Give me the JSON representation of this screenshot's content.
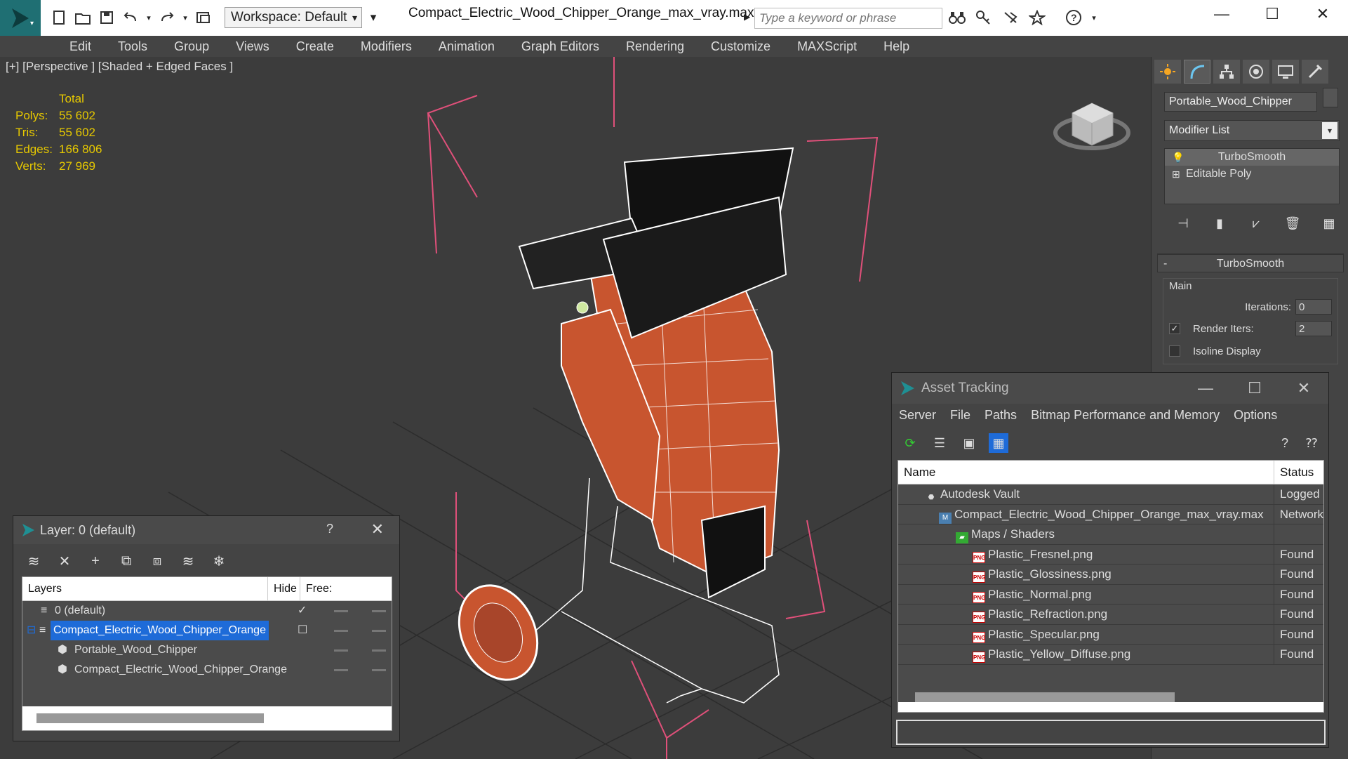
{
  "app": {
    "workspace": "Workspace: Default",
    "file_title": "Compact_Electric_Wood_Chipper_Orange_max_vray.max",
    "search_placeholder": "Type a keyword or phrase"
  },
  "menu": [
    "Edit",
    "Tools",
    "Group",
    "Views",
    "Create",
    "Modifiers",
    "Animation",
    "Graph Editors",
    "Rendering",
    "Customize",
    "MAXScript",
    "Help"
  ],
  "viewport": {
    "label": "[+] [Perspective ] [Shaded + Edged Faces ]",
    "stats": {
      "header": "Total",
      "rows": [
        {
          "k": "Polys:",
          "v": "55 602"
        },
        {
          "k": "Tris:",
          "v": "55 602"
        },
        {
          "k": "Edges:",
          "v": "166 806"
        },
        {
          "k": "Verts:",
          "v": "27 969"
        }
      ]
    }
  },
  "command_panel": {
    "object_name": "Portable_Wood_Chipper",
    "modifier_list": "Modifier List",
    "stack": [
      "TurboSmooth",
      "Editable Poly"
    ],
    "rollout": {
      "title": "TurboSmooth",
      "group": "Main",
      "iterations_label": "Iterations:",
      "iterations_value": "0",
      "render_iters_label": "Render Iters:",
      "render_iters_value": "2",
      "isoline_label": "Isoline Display"
    }
  },
  "layer_dialog": {
    "title": "Layer: 0 (default)",
    "help": "?",
    "columns": [
      "Layers",
      "Hide",
      "Free:"
    ],
    "rows": [
      {
        "name": "0 (default)"
      },
      {
        "name": "Compact_Electric_Wood_Chipper_Orange"
      },
      {
        "name": "Portable_Wood_Chipper"
      },
      {
        "name": "Compact_Electric_Wood_Chipper_Orange"
      }
    ]
  },
  "asset_dialog": {
    "title": "Asset Tracking",
    "menu": [
      "Server",
      "File",
      "Paths",
      "Bitmap Performance and Memory",
      "Options"
    ],
    "columns": [
      "Name",
      "Status"
    ],
    "rows": [
      {
        "name": "Autodesk Vault",
        "status": "Logged"
      },
      {
        "name": "Compact_Electric_Wood_Chipper_Orange_max_vray.max",
        "status": "Network"
      },
      {
        "name": "Maps / Shaders",
        "status": ""
      },
      {
        "name": "Plastic_Fresnel.png",
        "status": "Found"
      },
      {
        "name": "Plastic_Glossiness.png",
        "status": "Found"
      },
      {
        "name": "Plastic_Normal.png",
        "status": "Found"
      },
      {
        "name": "Plastic_Refraction.png",
        "status": "Found"
      },
      {
        "name": "Plastic_Specular.png",
        "status": "Found"
      },
      {
        "name": "Plastic_Yellow_Diffuse.png",
        "status": "Found"
      }
    ]
  },
  "colors": {
    "accent": "#1e6bd8",
    "stats": "#e6c800",
    "model_orange": "#c8552f",
    "gizmo": "#e0507a"
  }
}
